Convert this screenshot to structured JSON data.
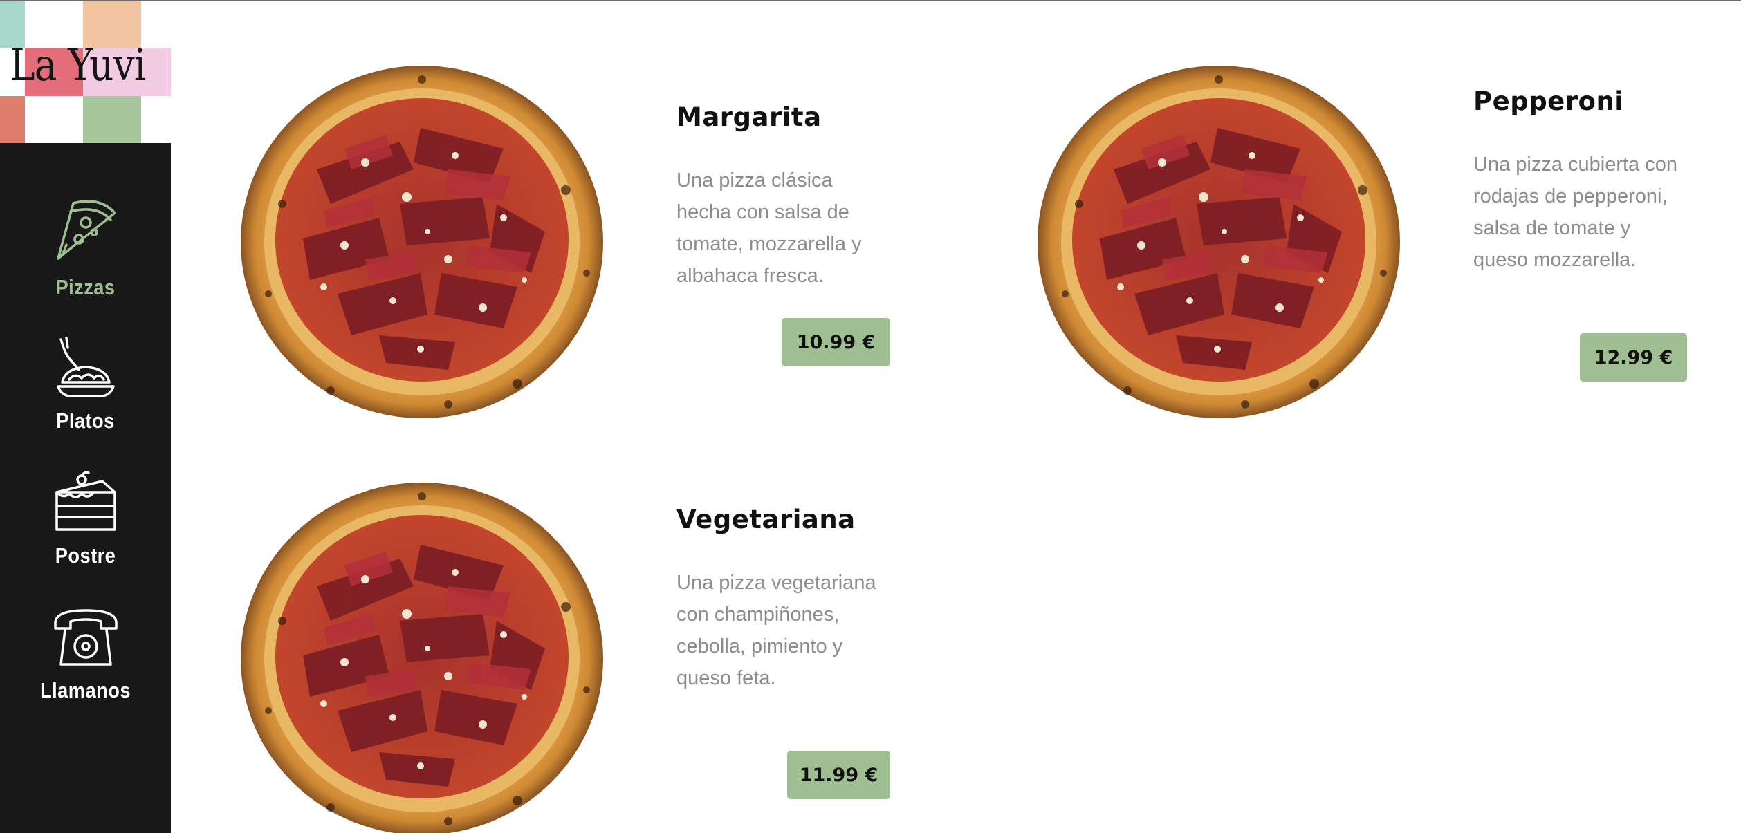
{
  "brand": {
    "name": "La Yuvi"
  },
  "nav": {
    "items": [
      {
        "label": "Pizzas",
        "icon": "pizza-slice-icon",
        "active": true
      },
      {
        "label": "Platos",
        "icon": "pasta-plate-icon",
        "active": false
      },
      {
        "label": "Postre",
        "icon": "cake-slice-icon",
        "active": false
      },
      {
        "label": "Llamanos",
        "icon": "telephone-icon",
        "active": false
      }
    ]
  },
  "menu": {
    "items": [
      {
        "name": "Margarita",
        "description": "Una pizza clásica hecha con salsa de tomate, mozzarella y albahaca fresca.",
        "price": "10.99 €"
      },
      {
        "name": "Pepperoni",
        "description": "Una pizza cubierta con rodajas de pepperoni, salsa de tomate y queso mozzarella.",
        "price": "12.99 €"
      },
      {
        "name": "Vegetariana",
        "description": "Una pizza vegetariana con champiñones, cebolla, pimiento y queso feta.",
        "price": "11.99 €"
      }
    ]
  },
  "colors": {
    "sidebar": "#181818",
    "accent_green": "#9fbf92",
    "text_dark": "#111111",
    "text_muted": "#8c8c8c"
  }
}
